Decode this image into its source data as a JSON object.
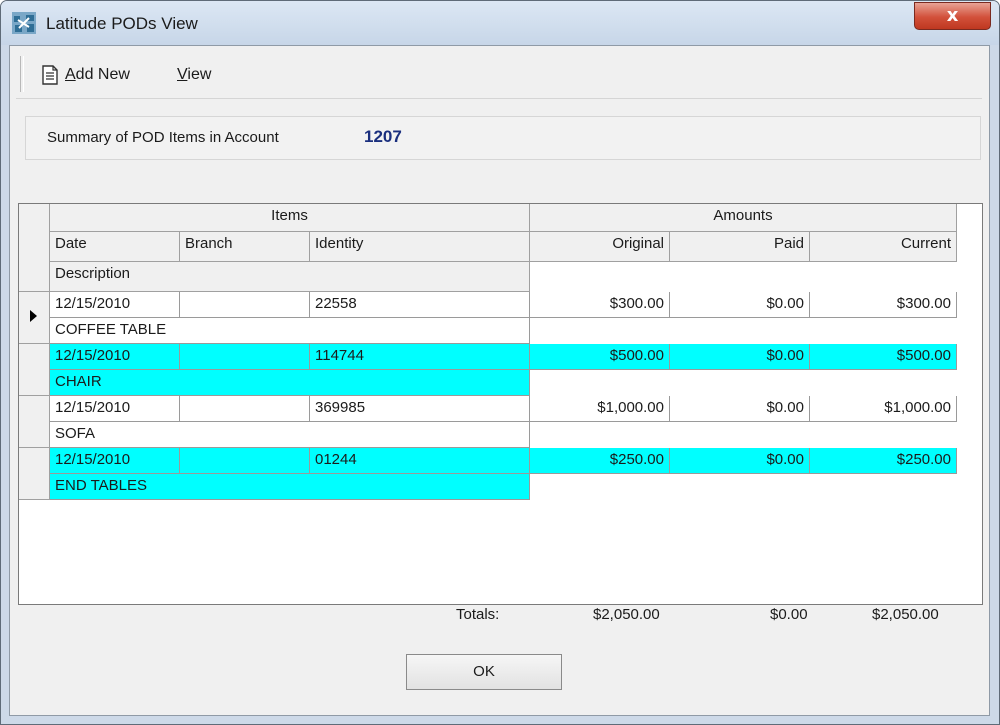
{
  "window": {
    "title": "Latitude PODs View",
    "close_glyph": "x",
    "accent_color": "#00ffff",
    "icon": "app-icon"
  },
  "toolbar": {
    "add_new_label": "Add New",
    "view_label": "View"
  },
  "summary": {
    "label": "Summary of POD Items in Account",
    "account_number": "1207"
  },
  "grid": {
    "group_headers": [
      "Items",
      "Amounts"
    ],
    "columns": [
      "Date",
      "Branch",
      "Identity",
      "Original",
      "Paid",
      "Current"
    ],
    "sub_header": "Description",
    "rows": [
      {
        "date": "12/15/2010",
        "branch": "",
        "identity": "22558",
        "original": "$300.00",
        "paid": "$0.00",
        "current": "$300.00",
        "description": "COFFEE TABLE",
        "selected": true,
        "highlighted": false
      },
      {
        "date": "12/15/2010",
        "branch": "",
        "identity": "114744",
        "original": "$500.00",
        "paid": "$0.00",
        "current": "$500.00",
        "description": "CHAIR",
        "selected": false,
        "highlighted": true
      },
      {
        "date": "12/15/2010",
        "branch": "",
        "identity": "369985",
        "original": "$1,000.00",
        "paid": "$0.00",
        "current": "$1,000.00",
        "description": "SOFA",
        "selected": false,
        "highlighted": false
      },
      {
        "date": "12/15/2010",
        "branch": "",
        "identity": "01244",
        "original": "$250.00",
        "paid": "$0.00",
        "current": "$250.00",
        "description": "END TABLES",
        "selected": false,
        "highlighted": true
      }
    ]
  },
  "totals": {
    "label": "Totals:",
    "original": "$2,050.00",
    "paid": "$0.00",
    "current": "$2,050.00"
  },
  "ok_label": "OK"
}
